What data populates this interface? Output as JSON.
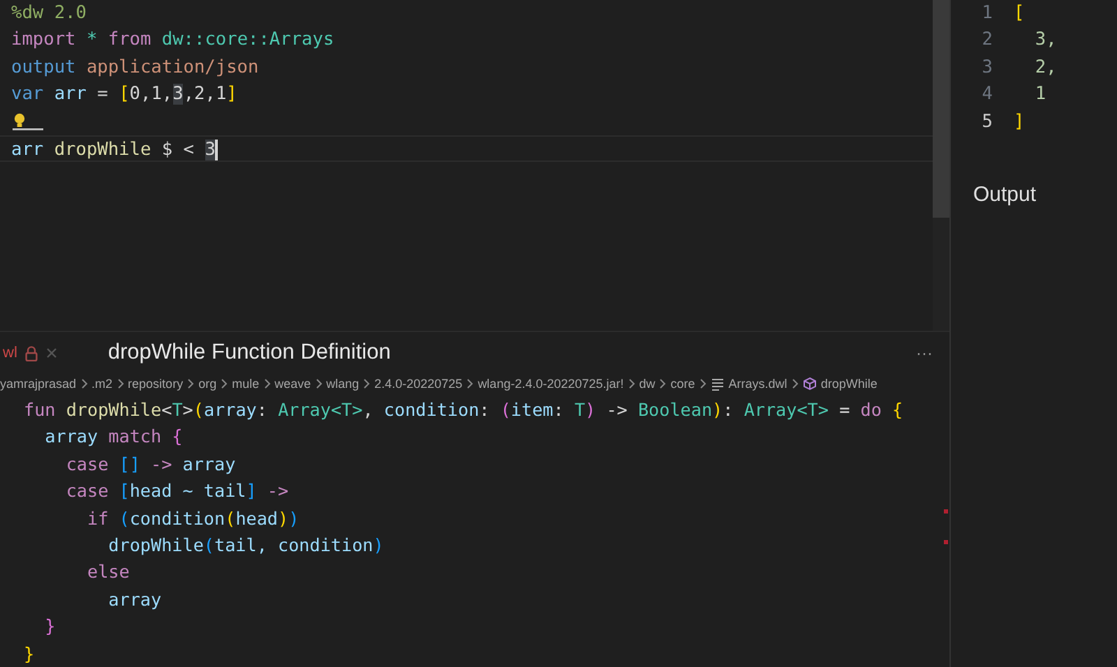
{
  "editor": {
    "lines": [
      {
        "kind": "code",
        "current": false,
        "tokens": [
          {
            "text": "%dw 2.0",
            "kind": "directive"
          }
        ]
      },
      {
        "kind": "code",
        "current": false,
        "tokens": [
          {
            "text": "import ",
            "kind": "keyword"
          },
          {
            "text": "* ",
            "kind": "type"
          },
          {
            "text": "from ",
            "kind": "keyword"
          },
          {
            "text": "dw::core::Arrays",
            "kind": "type"
          }
        ]
      },
      {
        "kind": "code",
        "current": false,
        "tokens": [
          {
            "text": "output ",
            "kind": "storage"
          },
          {
            "text": "application/json",
            "kind": "string"
          }
        ]
      },
      {
        "kind": "code",
        "current": false,
        "tokens": [
          {
            "text": "var ",
            "kind": "storage"
          },
          {
            "text": "arr",
            "kind": "variable"
          },
          {
            "text": " = ",
            "kind": "plain"
          },
          {
            "text": "[",
            "kind": "bracket1"
          },
          {
            "text": "0,1,",
            "kind": "plain"
          },
          {
            "text": "3",
            "kind": "match"
          },
          {
            "text": ",2,1",
            "kind": "plain"
          },
          {
            "text": "]",
            "kind": "bracket1"
          }
        ]
      },
      {
        "kind": "lightbulb"
      },
      {
        "kind": "code",
        "current": true,
        "tokens": [
          {
            "text": "arr ",
            "kind": "variable"
          },
          {
            "text": "dropWhile",
            "kind": "function"
          },
          {
            "text": " $ < ",
            "kind": "plain"
          },
          {
            "text": "3",
            "kind": "match"
          }
        ]
      }
    ]
  },
  "output": {
    "label": "Output",
    "lines": [
      {
        "number": "1",
        "current": false,
        "tokens": [
          {
            "text": "[",
            "kind": "bracket1"
          }
        ]
      },
      {
        "number": "2",
        "current": false,
        "tokens": [
          {
            "text": "  3,",
            "kind": "number"
          }
        ]
      },
      {
        "number": "3",
        "current": false,
        "tokens": [
          {
            "text": "  2,",
            "kind": "number"
          }
        ]
      },
      {
        "number": "4",
        "current": false,
        "tokens": [
          {
            "text": "  1",
            "kind": "number"
          }
        ]
      },
      {
        "number": "5",
        "current": true,
        "tokens": [
          {
            "text": "]",
            "kind": "bracket1"
          }
        ]
      }
    ]
  },
  "peek": {
    "tab": "wl",
    "title": "dropWhile Function Definition",
    "more": "···",
    "breadcrumb": [
      {
        "text": "yamrajprasad",
        "kind": "folder"
      },
      {
        "text": ".m2",
        "kind": "folder"
      },
      {
        "text": "repository",
        "kind": "folder"
      },
      {
        "text": "org",
        "kind": "folder"
      },
      {
        "text": "mule",
        "kind": "folder"
      },
      {
        "text": "weave",
        "kind": "folder"
      },
      {
        "text": "wlang",
        "kind": "folder"
      },
      {
        "text": "2.4.0-20220725",
        "kind": "folder"
      },
      {
        "text": "wlang-2.4.0-20220725.jar!",
        "kind": "folder"
      },
      {
        "text": "dw",
        "kind": "folder"
      },
      {
        "text": "core",
        "kind": "folder"
      },
      {
        "text": "Arrays.dwl",
        "kind": "file"
      },
      {
        "text": "dropWhile",
        "kind": "function"
      }
    ],
    "lines": [
      {
        "tokens": [
          {
            "text": "fun ",
            "kind": "keyword"
          },
          {
            "text": "dropWhile",
            "kind": "function"
          },
          {
            "text": "<",
            "kind": "plain"
          },
          {
            "text": "T",
            "kind": "type"
          },
          {
            "text": ">",
            "kind": "plain"
          },
          {
            "text": "(",
            "kind": "bracket1"
          },
          {
            "text": "array",
            "kind": "variable"
          },
          {
            "text": ": ",
            "kind": "plain"
          },
          {
            "text": "Array<T>",
            "kind": "type"
          },
          {
            "text": ", ",
            "kind": "plain"
          },
          {
            "text": "condition",
            "kind": "variable"
          },
          {
            "text": ": ",
            "kind": "plain"
          },
          {
            "text": "(",
            "kind": "bracket2"
          },
          {
            "text": "item",
            "kind": "variable"
          },
          {
            "text": ": ",
            "kind": "plain"
          },
          {
            "text": "T",
            "kind": "type"
          },
          {
            "text": ")",
            "kind": "bracket2"
          },
          {
            "text": " -> ",
            "kind": "plain"
          },
          {
            "text": "Boolean",
            "kind": "type"
          },
          {
            "text": ")",
            "kind": "bracket1"
          },
          {
            "text": ": ",
            "kind": "plain"
          },
          {
            "text": "Array<T>",
            "kind": "type"
          },
          {
            "text": " = ",
            "kind": "plain"
          },
          {
            "text": "do ",
            "kind": "keyword"
          },
          {
            "text": "{",
            "kind": "bracket1"
          }
        ]
      },
      {
        "tokens": [
          {
            "text": "  array ",
            "kind": "variable"
          },
          {
            "text": "match ",
            "kind": "keyword"
          },
          {
            "text": "{",
            "kind": "bracket2"
          }
        ]
      },
      {
        "tokens": [
          {
            "text": "    case ",
            "kind": "keyword"
          },
          {
            "text": "[]",
            "kind": "bracket3"
          },
          {
            "text": " -> ",
            "kind": "keyword"
          },
          {
            "text": "array",
            "kind": "variable"
          }
        ]
      },
      {
        "tokens": [
          {
            "text": "    case ",
            "kind": "keyword"
          },
          {
            "text": "[",
            "kind": "bracket3"
          },
          {
            "text": "head ~ tail",
            "kind": "variable"
          },
          {
            "text": "]",
            "kind": "bracket3"
          },
          {
            "text": " ->",
            "kind": "keyword"
          }
        ]
      },
      {
        "tokens": [
          {
            "text": "      if ",
            "kind": "keyword"
          },
          {
            "text": "(",
            "kind": "bracket3"
          },
          {
            "text": "condition",
            "kind": "variable"
          },
          {
            "text": "(",
            "kind": "bracket1"
          },
          {
            "text": "head",
            "kind": "variable"
          },
          {
            "text": ")",
            "kind": "bracket1"
          },
          {
            "text": ")",
            "kind": "bracket3"
          }
        ]
      },
      {
        "tokens": [
          {
            "text": "        dropWhile",
            "kind": "variable"
          },
          {
            "text": "(",
            "kind": "bracket3"
          },
          {
            "text": "tail, condition",
            "kind": "variable"
          },
          {
            "text": ")",
            "kind": "bracket3"
          }
        ]
      },
      {
        "tokens": [
          {
            "text": "      else",
            "kind": "keyword"
          }
        ]
      },
      {
        "tokens": [
          {
            "text": "        array",
            "kind": "variable"
          }
        ]
      },
      {
        "tokens": [
          {
            "text": "  }",
            "kind": "bracket2"
          }
        ]
      },
      {
        "tokens": [
          {
            "text": "}",
            "kind": "bracket1"
          }
        ]
      }
    ]
  }
}
